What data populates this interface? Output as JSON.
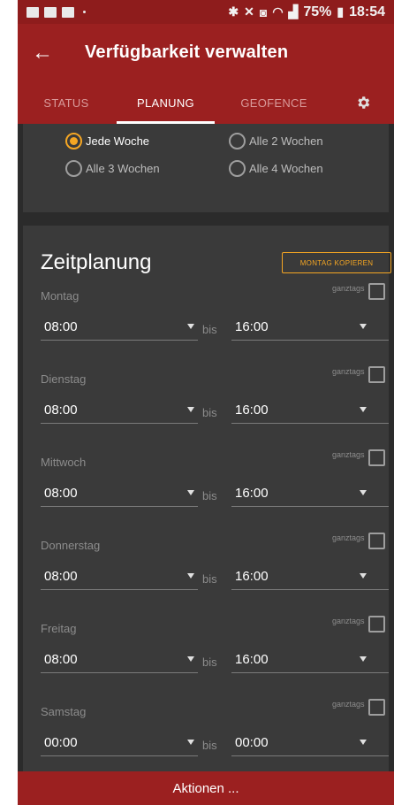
{
  "status_bar": {
    "battery": "75%",
    "time": "18:54"
  },
  "app_bar": {
    "title": "Verfügbarkeit verwalten"
  },
  "tabs": [
    {
      "label": "STATUS"
    },
    {
      "label": "PLANUNG"
    },
    {
      "label": "GEOFENCE"
    }
  ],
  "recurrence": {
    "options": [
      {
        "label": "Jede Woche",
        "selected": true
      },
      {
        "label": "Alle 2 Wochen",
        "selected": false
      },
      {
        "label": "Alle 3 Wochen",
        "selected": false
      },
      {
        "label": "Alle 4 Wochen",
        "selected": false
      }
    ]
  },
  "schedule": {
    "title": "Zeitplanung",
    "copy_button": "MONTAG KOPIEREN",
    "ganztags_label": "ganztags",
    "bis_label": "bis",
    "days": [
      {
        "name": "Montag",
        "from": "08:00",
        "to": "16:00"
      },
      {
        "name": "Dienstag",
        "from": "08:00",
        "to": "16:00"
      },
      {
        "name": "Mittwoch",
        "from": "08:00",
        "to": "16:00"
      },
      {
        "name": "Donnerstag",
        "from": "08:00",
        "to": "16:00"
      },
      {
        "name": "Freitag",
        "from": "08:00",
        "to": "16:00"
      },
      {
        "name": "Samstag",
        "from": "00:00",
        "to": "00:00"
      }
    ]
  },
  "action_bar": {
    "label": "Aktionen ..."
  },
  "colors": {
    "primary": "#9b2020",
    "accent": "#f5a623",
    "background": "#2b2b2b",
    "card": "#3a3a3a"
  }
}
